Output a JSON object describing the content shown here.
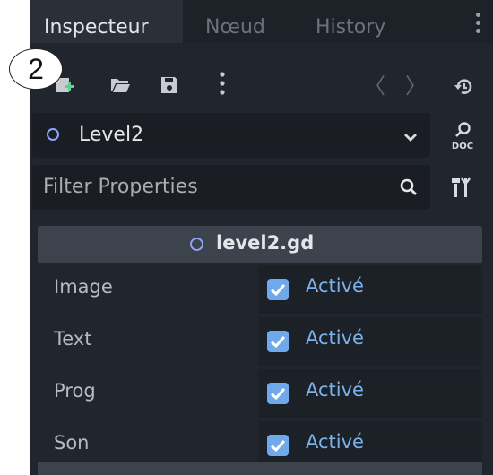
{
  "tabs": [
    {
      "label": "Inspecteur",
      "active": true
    },
    {
      "label": "Nœud",
      "active": false
    },
    {
      "label": "History",
      "active": false
    }
  ],
  "toolbar": {
    "icons": [
      "new-resource-icon",
      "open-folder-icon",
      "save-icon",
      "kebab-menu-icon",
      "back-icon",
      "forward-icon",
      "history-icon"
    ],
    "back_glyph": "〈",
    "forward_glyph": "〉"
  },
  "object_selector": {
    "value": "Level2"
  },
  "filter": {
    "placeholder": "Filter Properties"
  },
  "script_section": {
    "title": "level2.gd"
  },
  "properties": [
    {
      "name": "Image",
      "value_label": "Activé",
      "checked": true
    },
    {
      "name": "Text",
      "value_label": "Activé",
      "checked": true
    },
    {
      "name": "Prog",
      "value_label": "Activé",
      "checked": true
    },
    {
      "name": "Son",
      "value_label": "Activé",
      "checked": true
    }
  ],
  "callout": {
    "number": "2"
  },
  "colors": {
    "panel_bg": "#21262e",
    "accent_blue": "#6fa9ec",
    "script_ring": "#8da5f3"
  }
}
